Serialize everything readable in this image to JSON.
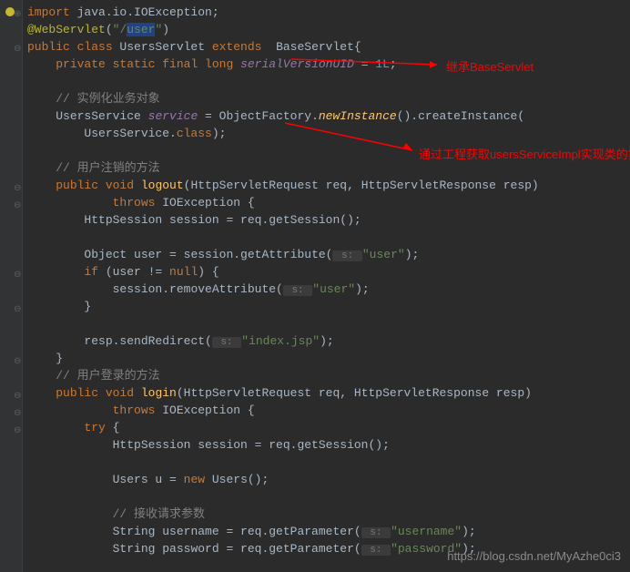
{
  "code": {
    "line1_keyword": "import ",
    "line1_pkg": "java.io.IOException",
    "line1_semi": ";",
    "line2_anno": "@WebServlet",
    "line2_paren": "(",
    "line2_str1": "\"/",
    "line2_str2": "user",
    "line2_str3": "\"",
    "line2_paren2": ")",
    "line3_public": "public class ",
    "line3_class": "UsersServlet ",
    "line3_extends": "extends  ",
    "line3_base": "BaseServlet{",
    "line4_modifiers": "private static final long ",
    "line4_field": "serialVersionUID",
    "line4_eq": " = ",
    "line4_val": "1L",
    "line4_semi": ";",
    "line6_comment": "// 实例化业务对象",
    "line7_type": "UsersService ",
    "line7_field": "service",
    "line7_eq": " = ObjectFactory.",
    "line7_method": "newInstance",
    "line7_rest": "().createInstance(",
    "line8_indent": "        UsersService.",
    "line8_class": "class",
    "line8_end": ");",
    "line10_comment": "// 用户注销的方法",
    "line11_public": "public void ",
    "line11_method": "logout",
    "line11_params": "(HttpServletRequest req, HttpServletResponse resp)",
    "line12_throws": "throws ",
    "line12_exc": "IOException {",
    "line13_type": "HttpSession session = req.getSession();",
    "line15_obj": "Object user = session.getAttribute(",
    "line15_hint": " s: ",
    "line15_str": "\"user\"",
    "line15_end": ");",
    "line16_if": "if ",
    "line16_cond": "(user != ",
    "line16_null": "null",
    "line16_brace": ") {",
    "line17_call": "session.removeAttribute(",
    "line17_hint": " s: ",
    "line17_str": "\"user\"",
    "line17_end": ");",
    "line18_brace": "}",
    "line20_resp": "resp.sendRedirect(",
    "line20_hint": " s: ",
    "line20_str": "\"index.jsp\"",
    "line20_end": ");",
    "line21_brace": "}",
    "line22_comment": "// 用户登录的方法",
    "line23_public": "public void ",
    "line23_method": "login",
    "line23_params": "(HttpServletRequest req, HttpServletResponse resp)",
    "line24_throws": "throws ",
    "line24_exc": "IOException {",
    "line25_try": "try ",
    "line25_brace": "{",
    "line26_sess": "HttpSession session = req.getSession();",
    "line28_users": "Users u = ",
    "line28_new": "new ",
    "line28_ctor": "Users();",
    "line30_comment": "// 接收请求参数",
    "line31_str": "String username = req.getParameter(",
    "line31_hint": " s: ",
    "line31_val": "\"username\"",
    "line31_end": ");",
    "line32_str": "String password = req.getParameter(",
    "line32_hint": " s: ",
    "line32_val": "\"password\"",
    "line32_end": ");"
  },
  "annotations": {
    "a1": "继承BaseServlet",
    "a2": "通过工程获取usersServiceImpl实现类的实例对象"
  },
  "watermark": "https://blog.csdn.net/MyAzhe0ci3"
}
